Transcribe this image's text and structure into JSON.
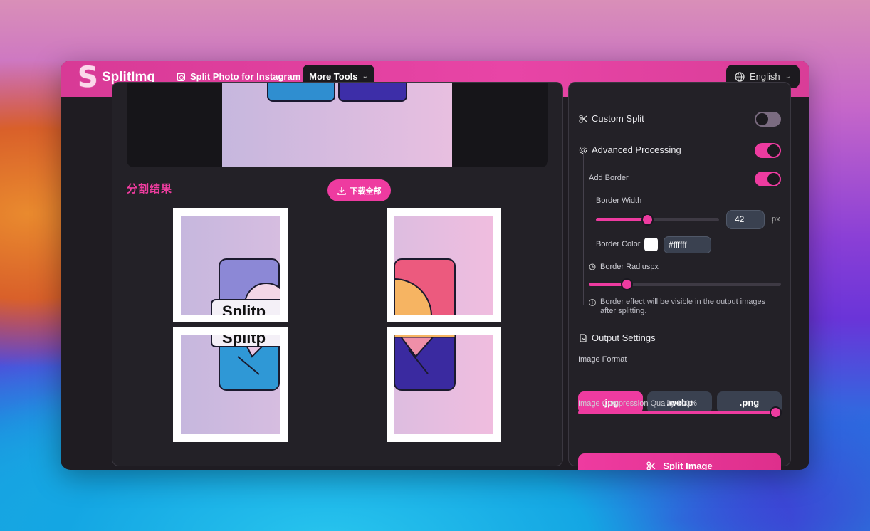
{
  "header": {
    "logo_mark": "S",
    "app_name": "SplitImg",
    "nav_link": "Split Photo for Instagram",
    "more_tools": "More Tools",
    "language": "English"
  },
  "results": {
    "title": "分割结果",
    "download_all": "下载全部",
    "tile_text": "Splitp"
  },
  "settings": {
    "custom_split": {
      "label": "Custom Split",
      "enabled": false
    },
    "advanced_processing": {
      "label": "Advanced Processing",
      "enabled": true
    },
    "add_border": {
      "label": "Add Border",
      "enabled": true
    },
    "border_width": {
      "label": "Border Width",
      "value": "42",
      "unit": "px"
    },
    "border_color": {
      "label": "Border Color",
      "value": "#ffffff"
    },
    "border_radius": {
      "label": "Border Radiuspx"
    },
    "border_note": "Border effect will be visible in the output images after splitting.",
    "output_settings": {
      "label": "Output Settings"
    },
    "image_format": {
      "label": "Image Format",
      "options": [
        ".jpg",
        ".webp",
        ".png"
      ],
      "selected": ".jpg"
    },
    "compression": {
      "label": "Image Compression Quality 100%"
    },
    "split_button": "Split Image"
  },
  "colors": {
    "accent": "#ee3ba0",
    "panel": "#232127",
    "input": "#3a4150"
  }
}
